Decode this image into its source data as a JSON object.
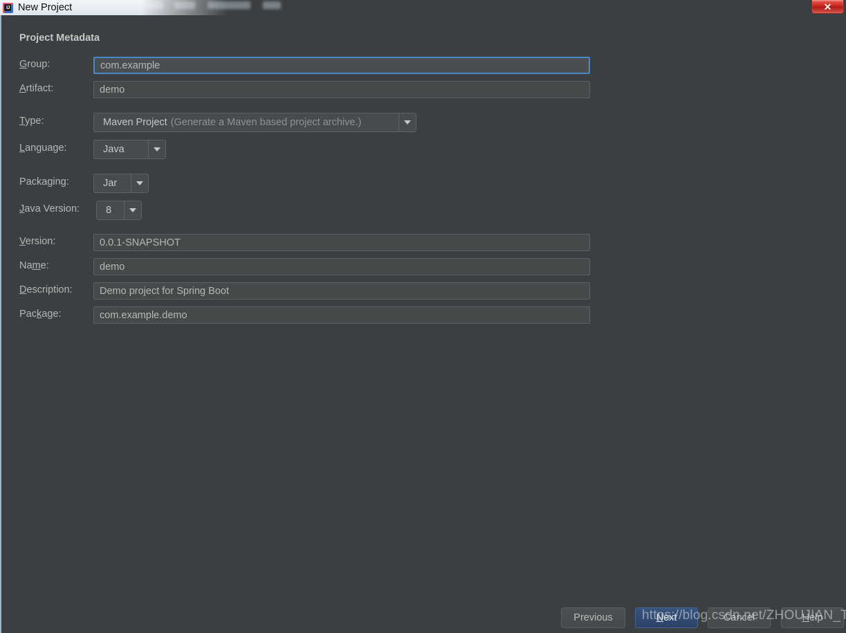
{
  "window": {
    "title": "New Project",
    "app_icon": "intellij-idea-icon",
    "close_label": "✕"
  },
  "form": {
    "section_title": "Project Metadata",
    "fields": [
      {
        "name": "group",
        "label_pre": "",
        "label_mnemonic": "G",
        "label_post": "roup:",
        "value": "com.example",
        "focused": true
      },
      {
        "name": "artifact",
        "label_pre": "",
        "label_mnemonic": "A",
        "label_post": "rtifact:",
        "value": "demo",
        "focused": false
      },
      {
        "name": "version",
        "label_pre": "",
        "label_mnemonic": "V",
        "label_post": "ersion:",
        "value": "0.0.1-SNAPSHOT",
        "focused": false
      },
      {
        "name": "project-name",
        "label_pre": "Na",
        "label_mnemonic": "m",
        "label_post": "e:",
        "value": "demo",
        "focused": false
      },
      {
        "name": "description",
        "label_pre": "",
        "label_mnemonic": "D",
        "label_post": "escription:",
        "value": "Demo project for Spring Boot",
        "focused": false
      },
      {
        "name": "package",
        "label_pre": "Pac",
        "label_mnemonic": "k",
        "label_post": "age:",
        "value": "com.example.demo",
        "focused": false
      }
    ],
    "combos": [
      {
        "name": "type",
        "label_pre": "",
        "label_mnemonic": "T",
        "label_post": "ype:",
        "value": "Maven Project",
        "value_hint": "(Generate a Maven based project archive.)"
      },
      {
        "name": "language",
        "label_pre": "",
        "label_mnemonic": "L",
        "label_post": "anguage:",
        "value": "Java",
        "value_hint": ""
      },
      {
        "name": "packaging",
        "label_pre": "Packa",
        "label_mnemonic": "g",
        "label_post": "ing:",
        "value": "Jar",
        "value_hint": ""
      },
      {
        "name": "java-version",
        "label_pre": "",
        "label_mnemonic": "J",
        "label_post": "ava Version:",
        "value": "8",
        "value_hint": ""
      }
    ]
  },
  "footer": {
    "previous": "Previous",
    "next_pre": "",
    "next_mnemonic": "N",
    "next_post": "ext",
    "cancel": "Cancel",
    "help_pre": "",
    "help_mnemonic": "H",
    "help_post": "elp"
  },
  "watermark": {
    "text": "https://blog.csdn.net/ZHOUJIAN_TANK"
  }
}
